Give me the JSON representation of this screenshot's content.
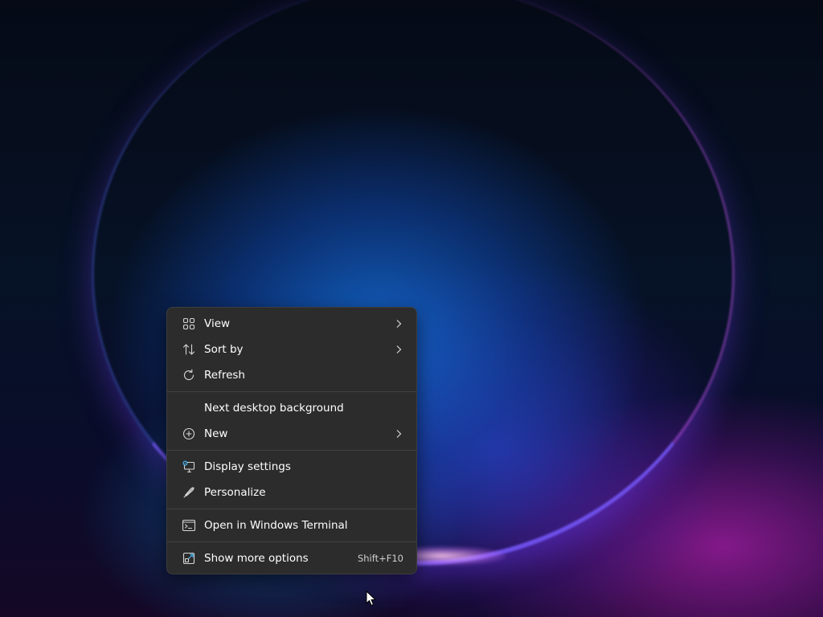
{
  "desktop": {
    "context_menu": {
      "items": [
        {
          "label": "View",
          "icon": "grid-view-icon",
          "has_submenu": true
        },
        {
          "label": "Sort by",
          "icon": "sort-icon",
          "has_submenu": true
        },
        {
          "label": "Refresh",
          "icon": "refresh-icon",
          "has_submenu": false
        },
        {
          "label": "Next desktop background",
          "icon": "",
          "has_submenu": false
        },
        {
          "label": "New",
          "icon": "plus-circle-icon",
          "has_submenu": true
        },
        {
          "label": "Display settings",
          "icon": "display-settings-icon",
          "has_submenu": false
        },
        {
          "label": "Personalize",
          "icon": "pen-icon",
          "has_submenu": false
        },
        {
          "label": "Open in Windows Terminal",
          "icon": "terminal-icon",
          "has_submenu": false
        },
        {
          "label": "Show more options",
          "icon": "show-more-icon",
          "has_submenu": false,
          "shortcut": "Shift+F10"
        }
      ]
    }
  },
  "colors": {
    "menu_background": "#2c2c2c",
    "menu_border": "#3d3d3d",
    "separator": "#414141",
    "text": "#ffffff",
    "shortcut_text": "#cfcfcf",
    "icon_accent": "#4cc2ff"
  }
}
